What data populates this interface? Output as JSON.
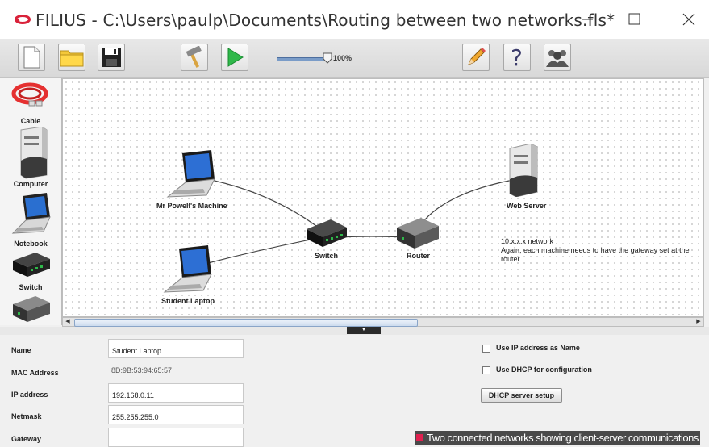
{
  "window": {
    "title": "FILIUS - C:\\Users\\paulp\\Documents\\Routing between two networks.fls*",
    "controls": [
      "minimize",
      "maximize",
      "close"
    ]
  },
  "toolbar": {
    "buttons": [
      "new-file-icon",
      "open-folder-icon",
      "save-disk-icon",
      "design-mode-hammer-icon",
      "simulation-play-icon",
      "edit-pencil-icon",
      "help-question-icon",
      "about-people-icon"
    ],
    "speed_label": "100%",
    "speed_value_percent": 100
  },
  "palette": {
    "items": [
      {
        "label": "Cable",
        "icon": "cable-icon"
      },
      {
        "label": "Computer",
        "icon": "computer-icon"
      },
      {
        "label": "Notebook",
        "icon": "notebook-icon"
      },
      {
        "label": "Switch",
        "icon": "switch-icon"
      },
      {
        "label": "",
        "icon": "router-icon"
      }
    ]
  },
  "canvas": {
    "nodes": [
      {
        "id": "mr-powells-machine",
        "label": "Mr Powell's Machine",
        "type": "notebook"
      },
      {
        "id": "student-laptop",
        "label": "Student Laptop",
        "type": "notebook"
      },
      {
        "id": "switch",
        "label": "Switch",
        "type": "switch"
      },
      {
        "id": "router",
        "label": "Router",
        "type": "router"
      },
      {
        "id": "web-server",
        "label": "Web Server",
        "type": "computer"
      }
    ],
    "links": [
      [
        "mr-powells-machine",
        "switch"
      ],
      [
        "student-laptop",
        "switch"
      ],
      [
        "switch",
        "router"
      ],
      [
        "router",
        "web-server"
      ]
    ],
    "note_line1": "10.x.x.x network",
    "note_line2": "Again, each machine needs to have the gateway set at the router."
  },
  "properties": {
    "name_label": "Name",
    "name_value": "Student Laptop",
    "mac_label": "MAC Address",
    "mac_value": "8D:9B:53:94:65:57",
    "ip_label": "IP address",
    "ip_value": "192.168.0.11",
    "netmask_label": "Netmask",
    "netmask_value": "255.255.255.0",
    "gateway_label": "Gateway",
    "gateway_value": "",
    "use_ip_as_name_label": "Use IP address as Name",
    "use_ip_as_name_checked": false,
    "use_dhcp_label": "Use DHCP for configuration",
    "use_dhcp_checked": false,
    "dhcp_setup_label": "DHCP server setup"
  },
  "caption": "Two connected networks showing client-server communications",
  "colors": {
    "accent": "#e0204f",
    "logo": "#d9223a",
    "link": "#444444"
  }
}
